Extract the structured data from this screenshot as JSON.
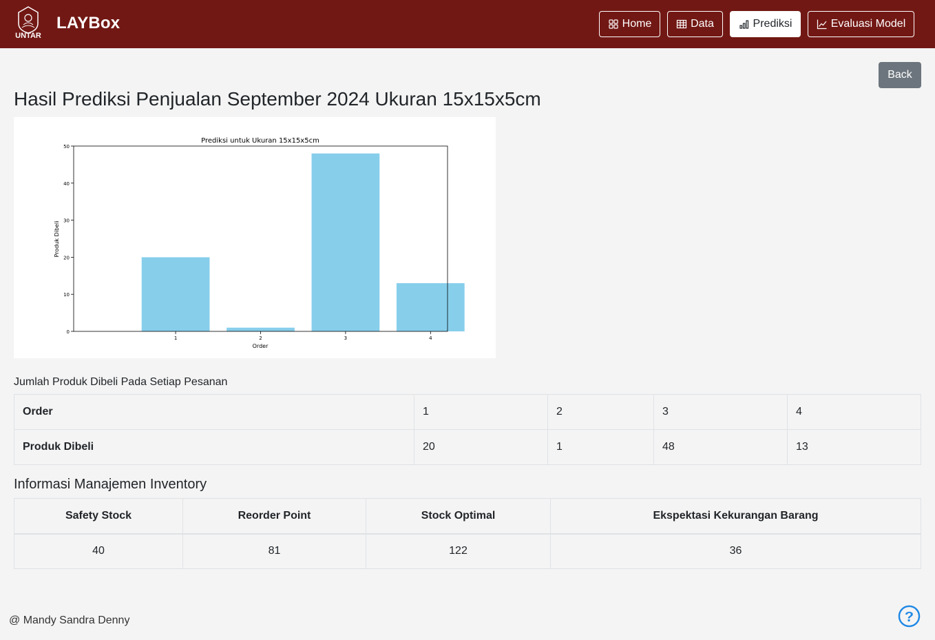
{
  "header": {
    "logo_text": "UNTAR",
    "brand": "LAYBox",
    "nav": [
      {
        "label": "Home",
        "icon": "grid-icon"
      },
      {
        "label": "Data",
        "icon": "table-icon"
      },
      {
        "label": "Prediksi",
        "icon": "bar-chart-icon",
        "active": true
      },
      {
        "label": "Evaluasi Model",
        "icon": "line-chart-icon"
      }
    ],
    "color": "#721814"
  },
  "back_label": "Back",
  "page_title": "Hasil Prediksi Penjualan September 2024 Ukuran 15x15x5cm",
  "chart_data": {
    "type": "bar",
    "title": "Prediksi untuk Ukuran 15x15x5cm",
    "xlabel": "Order",
    "ylabel": "Produk Dibeli",
    "categories": [
      "1",
      "2",
      "3",
      "4"
    ],
    "values": [
      20,
      1,
      48,
      13
    ],
    "ylim": [
      0,
      50
    ],
    "yticks": [
      0,
      10,
      20,
      30,
      40,
      50
    ],
    "bar_color": "#87CEEB",
    "grid": false
  },
  "orders": {
    "caption": "Jumlah Produk Dibeli Pada Setiap Pesanan",
    "row_order_label": "Order",
    "row_qty_label": "Produk Dibeli",
    "order_values": [
      "1",
      "2",
      "3",
      "4"
    ],
    "qty_values": [
      "20",
      "1",
      "48",
      "13"
    ]
  },
  "inventory": {
    "title": "Informasi Manajemen Inventory",
    "headers": [
      "Safety Stock",
      "Reorder Point",
      "Stock Optimal",
      "Ekspektasi Kekurangan Barang"
    ],
    "values": [
      "40",
      "81",
      "122",
      "36"
    ]
  },
  "footer": "@ Mandy Sandra Denny",
  "help_color": "#1E88E5"
}
